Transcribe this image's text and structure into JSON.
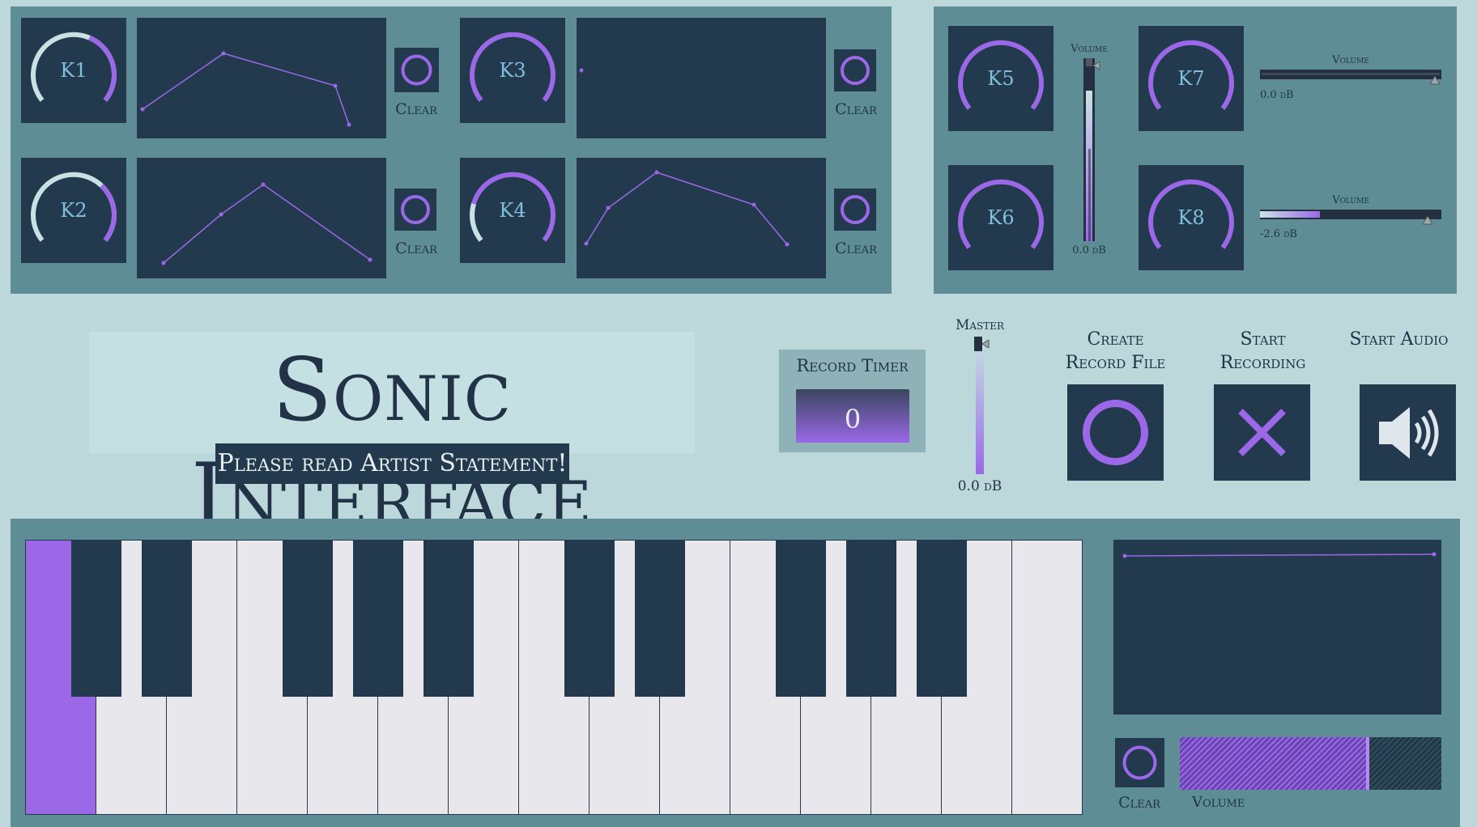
{
  "title": "Sonic Interface",
  "subtitle": "Please read Artist Statement!",
  "knobs": [
    {
      "label": "K1",
      "value": 0.55
    },
    {
      "label": "K2",
      "value": 0.45
    },
    {
      "label": "K3",
      "value": 1.0
    },
    {
      "label": "K4",
      "value": 0.22
    },
    {
      "label": "K5",
      "value": 1.0
    },
    {
      "label": "K6",
      "value": 1.0
    },
    {
      "label": "K7",
      "value": 1.0
    },
    {
      "label": "K8",
      "value": 1.0
    }
  ],
  "clear_label": "Clear",
  "volume_label": "Volume",
  "volume_sliders": [
    {
      "label": "Volume",
      "readout": "0.0 dB"
    },
    {
      "label": "Volume",
      "readout": "0.0 dB"
    },
    {
      "label": "Volume",
      "readout": "-2.6 dB"
    }
  ],
  "master": {
    "label": "Master",
    "readout": "0.0 dB"
  },
  "record_timer": {
    "label": "Record Timer",
    "value": "0"
  },
  "controls": {
    "create_record_file": "Create Record File",
    "start_recording": "Start Recording",
    "start_audio": "Start Audio"
  },
  "keyboard": {
    "active_key_index": 0
  },
  "colors": {
    "accent": "#9b68e8",
    "panel": "#5f8d95",
    "dark": "#233a4e",
    "background": "#bcd8da"
  }
}
